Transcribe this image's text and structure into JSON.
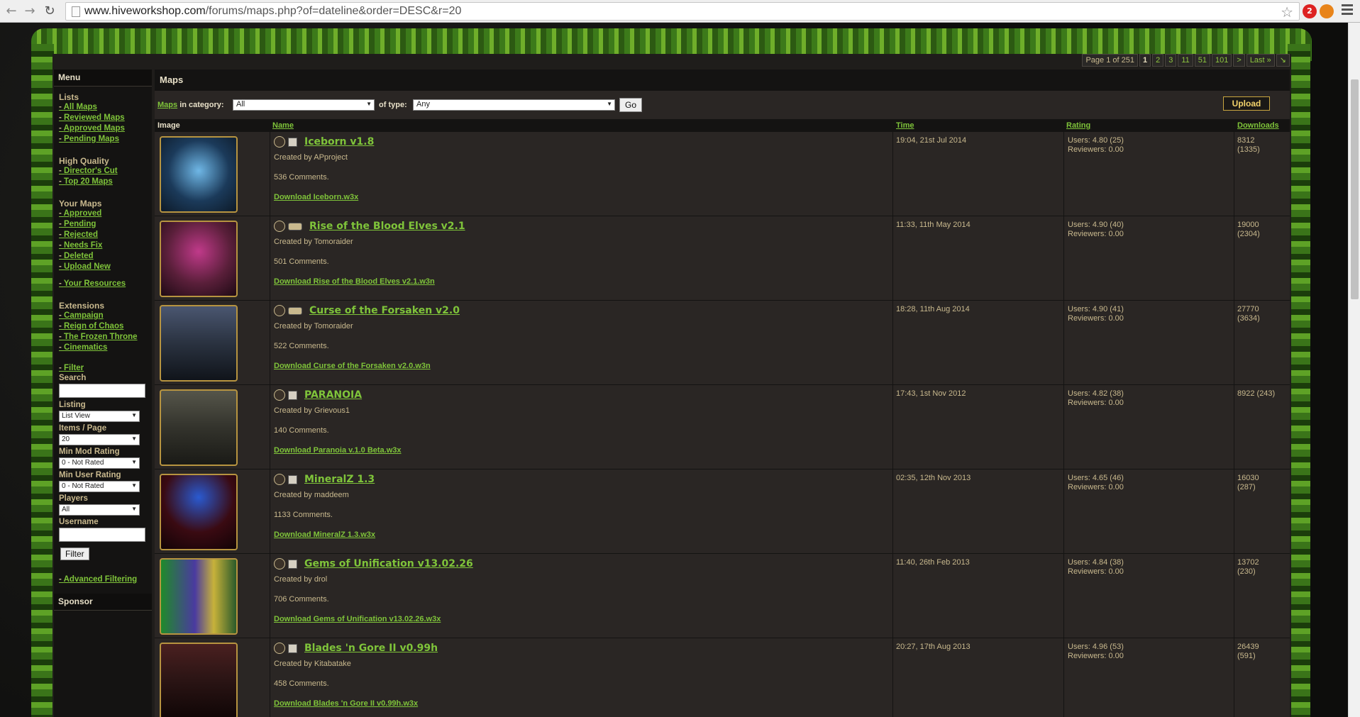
{
  "browser": {
    "url_host": "www.hiveworkshop.com",
    "url_path": "/forums/maps.php?of=dateline&order=DESC&r=20",
    "ext_badge": "2"
  },
  "pager": {
    "summary": "Page 1 of 251",
    "pages": [
      "1",
      "2",
      "3",
      "11",
      "51",
      "101"
    ],
    "next": ">",
    "last": "Last »"
  },
  "sidebar": {
    "menu_title": "Menu",
    "lists_title": "Lists",
    "lists": [
      "All Maps",
      "Reviewed Maps",
      "Approved Maps",
      "Pending Maps"
    ],
    "hq_title": "High Quality",
    "hq": [
      "Director's Cut",
      "Top 20 Maps"
    ],
    "your_title": "Your Maps",
    "your": [
      "Approved",
      "Pending",
      "Rejected",
      "Needs Fix",
      "Deleted",
      "Upload New"
    ],
    "your_resources": "Your Resources",
    "ext_title": "Extensions",
    "ext": [
      "Campaign",
      "Reign of Chaos",
      "The Frozen Throne",
      "Cinematics"
    ],
    "filter_title": "Filter",
    "search_label": "Search",
    "listing_label": "Listing",
    "listing_value": "List View",
    "items_label": "Items / Page",
    "items_value": "20",
    "minmod_label": "Min Mod Rating",
    "minmod_value": "0 - Not Rated",
    "minuser_label": "Min User Rating",
    "minuser_value": "0 - Not Rated",
    "players_label": "Players",
    "players_value": "All",
    "username_label": "Username",
    "filter_button": "Filter",
    "advanced": "Advanced Filtering",
    "sponsor_title": "Sponsor"
  },
  "main": {
    "title": "Maps",
    "filter": {
      "maps_link": "Maps",
      "in_category": "in category:",
      "category_value": "All",
      "of_type": "of type:",
      "type_value": "Any",
      "go": "Go",
      "upload": "Upload"
    },
    "columns": {
      "image": "Image",
      "name": "Name",
      "time": "Time",
      "rating": "Rating",
      "downloads": "Downloads"
    },
    "rows": [
      {
        "title": "Iceborn v1.8",
        "by": "Created by APproject",
        "comments": "536 Comments.",
        "download": "Download Iceborn.w3x",
        "time": "19:04, 21st Jul 2014",
        "users": "Users: 4.80 (25)",
        "reviewers": "Reviewers: 0.00",
        "dl1": "8312",
        "dl2": "(1335)",
        "thumb_color": "#1b3a5a"
      },
      {
        "title": "Rise of the Blood Elves v2.1",
        "by": "Created by Tomoraider",
        "comments": "501 Comments.",
        "download": "Download Rise of the Blood Elves v2.1.w3n",
        "time": "11:33, 11th May 2014",
        "users": "Users: 4.90 (40)",
        "reviewers": "Reviewers: 0.00",
        "dl1": "19000",
        "dl2": "(2304)",
        "thumb_color": "#5a1f3a"
      },
      {
        "title": "Curse of the Forsaken v2.0",
        "by": "Created by Tomoraider",
        "comments": "522 Comments.",
        "download": "Download Curse of the Forsaken v2.0.w3n",
        "time": "18:28, 11th Aug 2014",
        "users": "Users: 4.90 (41)",
        "reviewers": "Reviewers: 0.00",
        "dl1": "27770",
        "dl2": "(3634)",
        "thumb_color": "#2a3240"
      },
      {
        "title": "PARANOIA",
        "by": "Created by Grievous1",
        "comments": "140 Comments.",
        "download": "Download Paranoia v.1.0 Beta.w3x",
        "time": "17:43, 1st Nov 2012",
        "users": "Users: 4.82 (38)",
        "reviewers": "Reviewers: 0.00",
        "dl1": "8922 (243)",
        "dl2": "",
        "thumb_color": "#33332c"
      },
      {
        "title": "MineralZ 1.3",
        "by": "Created by maddeem",
        "comments": "1133 Comments.",
        "download": "Download MineralZ 1.3.w3x",
        "time": "02:35, 12th Nov 2013",
        "users": "Users: 4.65 (46)",
        "reviewers": "Reviewers: 0.00",
        "dl1": "16030",
        "dl2": "(287)",
        "thumb_color": "#3a0a12"
      },
      {
        "title": "Gems of Unification v13.02.26",
        "by": "Created by drol",
        "comments": "706 Comments.",
        "download": "Download Gems of Unification v13.02.26.w3x",
        "time": "11:40, 26th Feb 2013",
        "users": "Users: 4.84 (38)",
        "reviewers": "Reviewers: 0.00",
        "dl1": "13702",
        "dl2": "(230)",
        "thumb_color": "#2a5a2a"
      },
      {
        "title": "Blades 'n Gore II v0.99h",
        "by": "Created by Kitabatake",
        "comments": "458 Comments.",
        "download": "Download Blades 'n Gore II v0.99h.w3x",
        "time": "20:27, 17th Aug 2013",
        "users": "Users: 4.96 (53)",
        "reviewers": "Reviewers: 0.00",
        "dl1": "26439",
        "dl2": "(591)",
        "thumb_color": "#2a1414"
      }
    ]
  }
}
